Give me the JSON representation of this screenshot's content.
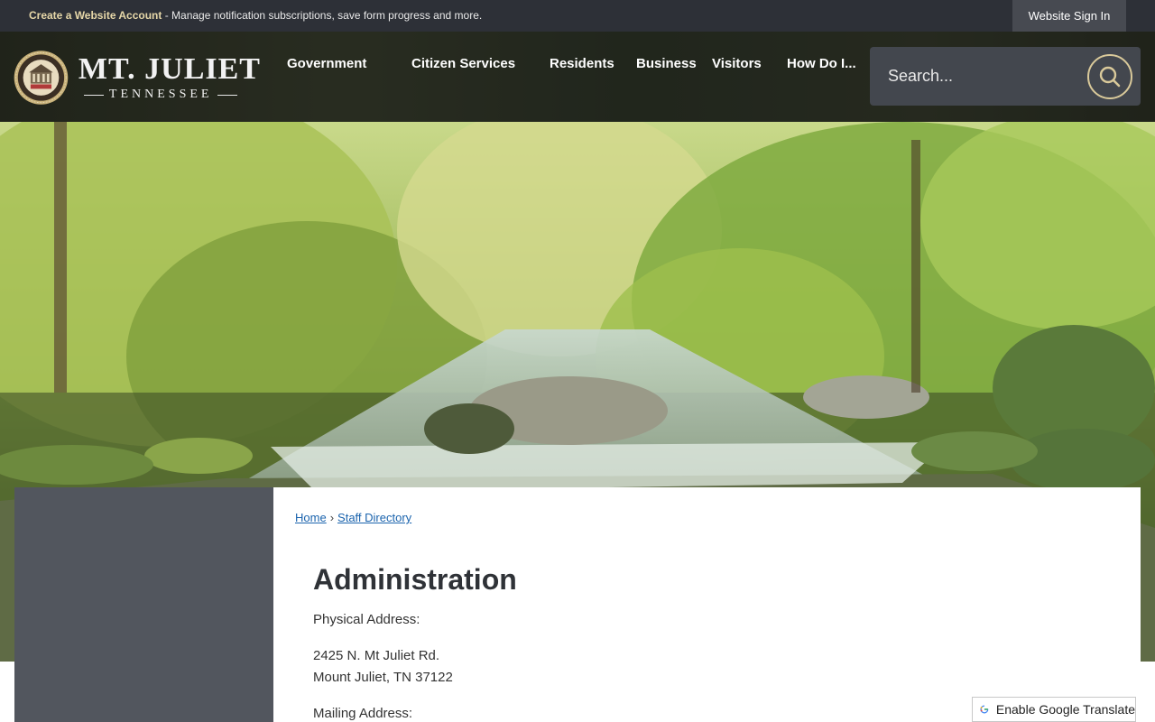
{
  "topbar": {
    "account_link": "Create a Website Account",
    "account_text": " - Manage notification subscriptions, save form progress and more.",
    "signin_label": "Website Sign In"
  },
  "header": {
    "logo_name": "MT. JULIET",
    "logo_sub": "TENNESSEE",
    "nav": [
      "Government",
      "Citizen Services",
      "Residents",
      "Business",
      "Visitors",
      "How Do I..."
    ],
    "search_placeholder": "Search..."
  },
  "breadcrumb": {
    "home": "Home",
    "separator": "›",
    "current": "Staff Directory"
  },
  "main": {
    "title": "Administration",
    "physical_label": "Physical Address:",
    "physical_line1": "2425 N. Mt Juliet Rd.",
    "physical_line2": "Mount Juliet, TN 37122",
    "mailing_label": "Mailing Address:"
  },
  "translate": {
    "label": "Enable Google Translate"
  },
  "colors": {
    "topbar": "#2d3037",
    "accent_gold": "#d9c99a",
    "sidebar": "#52565e",
    "link": "#1a63ad"
  },
  "icons": [
    "city-seal-icon",
    "search-icon",
    "google-translate-icon"
  ]
}
